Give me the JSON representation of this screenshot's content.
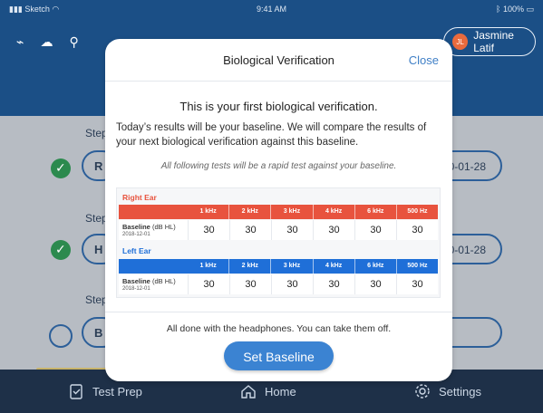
{
  "status_bar": {
    "carrier": "Sketch",
    "time": "9:41 AM",
    "battery": "100%"
  },
  "toolbar": {
    "icons": [
      "wifi-off-icon",
      "cloud-upload-icon",
      "network-icon"
    ]
  },
  "user": {
    "initials": "JL",
    "name": "Jasmine Latif"
  },
  "background_steps": [
    {
      "label": "Step",
      "letter": "R",
      "date": "0-01-28",
      "status": "done"
    },
    {
      "label": "Step",
      "letter": "H",
      "date": "0-01-28",
      "status": "done"
    },
    {
      "label": "Step",
      "letter": "B",
      "date": "",
      "status": "pending"
    }
  ],
  "modal": {
    "title": "Biological Verification",
    "close_label": "Close",
    "heading": "This is your first biological verification.",
    "body": "Today’s results will be your baseline.  We will compare the results of your next biological verification against this baseline.",
    "note": "All following tests will be a rapid test against your baseline.",
    "frequencies": [
      "1 kHz",
      "2 kHz",
      "3 kHz",
      "4 kHz",
      "6 kHz",
      "500 Hz"
    ],
    "ears": [
      {
        "name": "Right Ear",
        "color": "#e8533e",
        "row_label": "Baseline",
        "row_unit": "(dB HL)",
        "row_date": "2018-12-01",
        "values": [
          "30",
          "30",
          "30",
          "30",
          "30",
          "30"
        ]
      },
      {
        "name": "Left Ear",
        "color": "#1f6fd8",
        "row_label": "Baseline",
        "row_unit": "(dB HL)",
        "row_date": "2018-12-01",
        "values": [
          "30",
          "30",
          "30",
          "30",
          "30",
          "30"
        ]
      }
    ],
    "done_text": "All done with the headphones. You can take them off.",
    "button_label": "Set Baseline"
  },
  "tabbar": {
    "tabs": [
      {
        "label": "Test Prep",
        "icon": "clipboard-check-icon"
      },
      {
        "label": "Home",
        "icon": "home-icon"
      },
      {
        "label": "Settings",
        "icon": "gear-icon"
      }
    ]
  },
  "colors": {
    "accent": "#3b83d2",
    "header_blue": "#1b4f86",
    "right_ear": "#e8533e",
    "left_ear": "#1f6fd8"
  }
}
